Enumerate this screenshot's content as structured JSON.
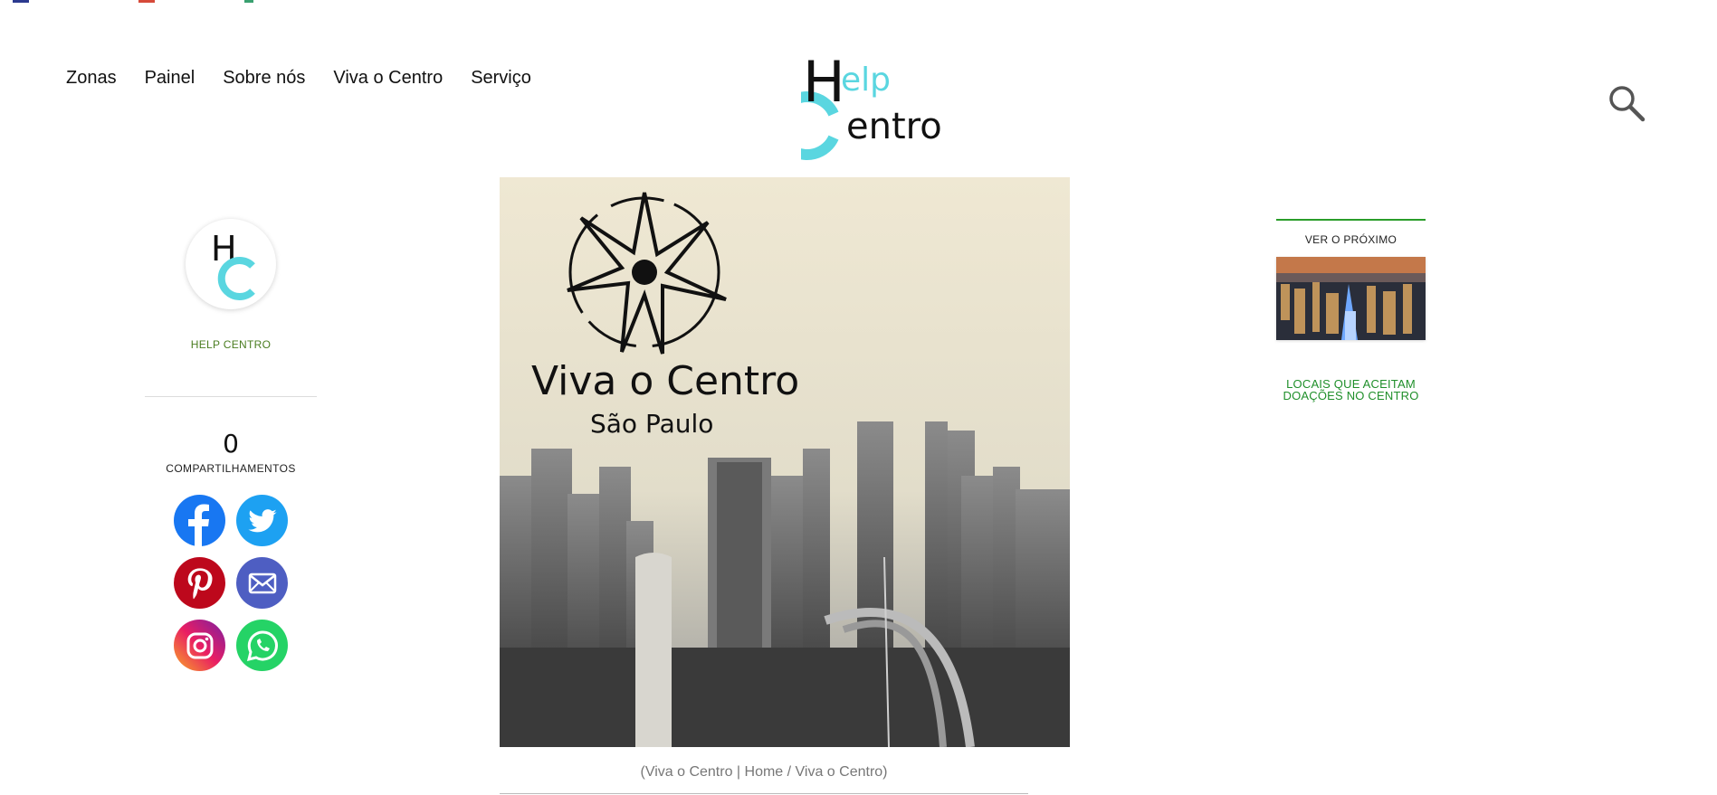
{
  "nav": {
    "items": [
      {
        "label": "Zonas"
      },
      {
        "label": "Painel"
      },
      {
        "label": "Sobre nós"
      },
      {
        "label": "Viva o Centro"
      },
      {
        "label": "Serviço"
      }
    ]
  },
  "logo": {
    "line1": "Help",
    "line2": "Centro"
  },
  "author": {
    "name": "HELP CENTRO",
    "avatar_letters": "HC"
  },
  "share": {
    "count": "0",
    "label": "COMPARTILHAMENTOS",
    "networks": [
      "facebook-icon",
      "twitter-icon",
      "pinterest-icon",
      "email-icon",
      "instagram-icon",
      "whatsapp-icon"
    ]
  },
  "hero": {
    "title_line1": "Viva o Centro",
    "title_line2": "São Paulo",
    "caption": "(Viva o Centro | Home / Viva o Centro)"
  },
  "next": {
    "label": "VER O PRÓXIMO",
    "title": "LOCAIS QUE ACEITAM DOAÇÕES NO CENTRO"
  },
  "colors": {
    "accent_cyan": "#5ad6e0",
    "author_green": "#4a7d20",
    "link_green": "#1f8f2a",
    "facebook": "#1877f2",
    "twitter": "#1da1f2",
    "pinterest": "#bd081c",
    "email": "#4e5ec2",
    "whatsapp": "#25d366"
  }
}
